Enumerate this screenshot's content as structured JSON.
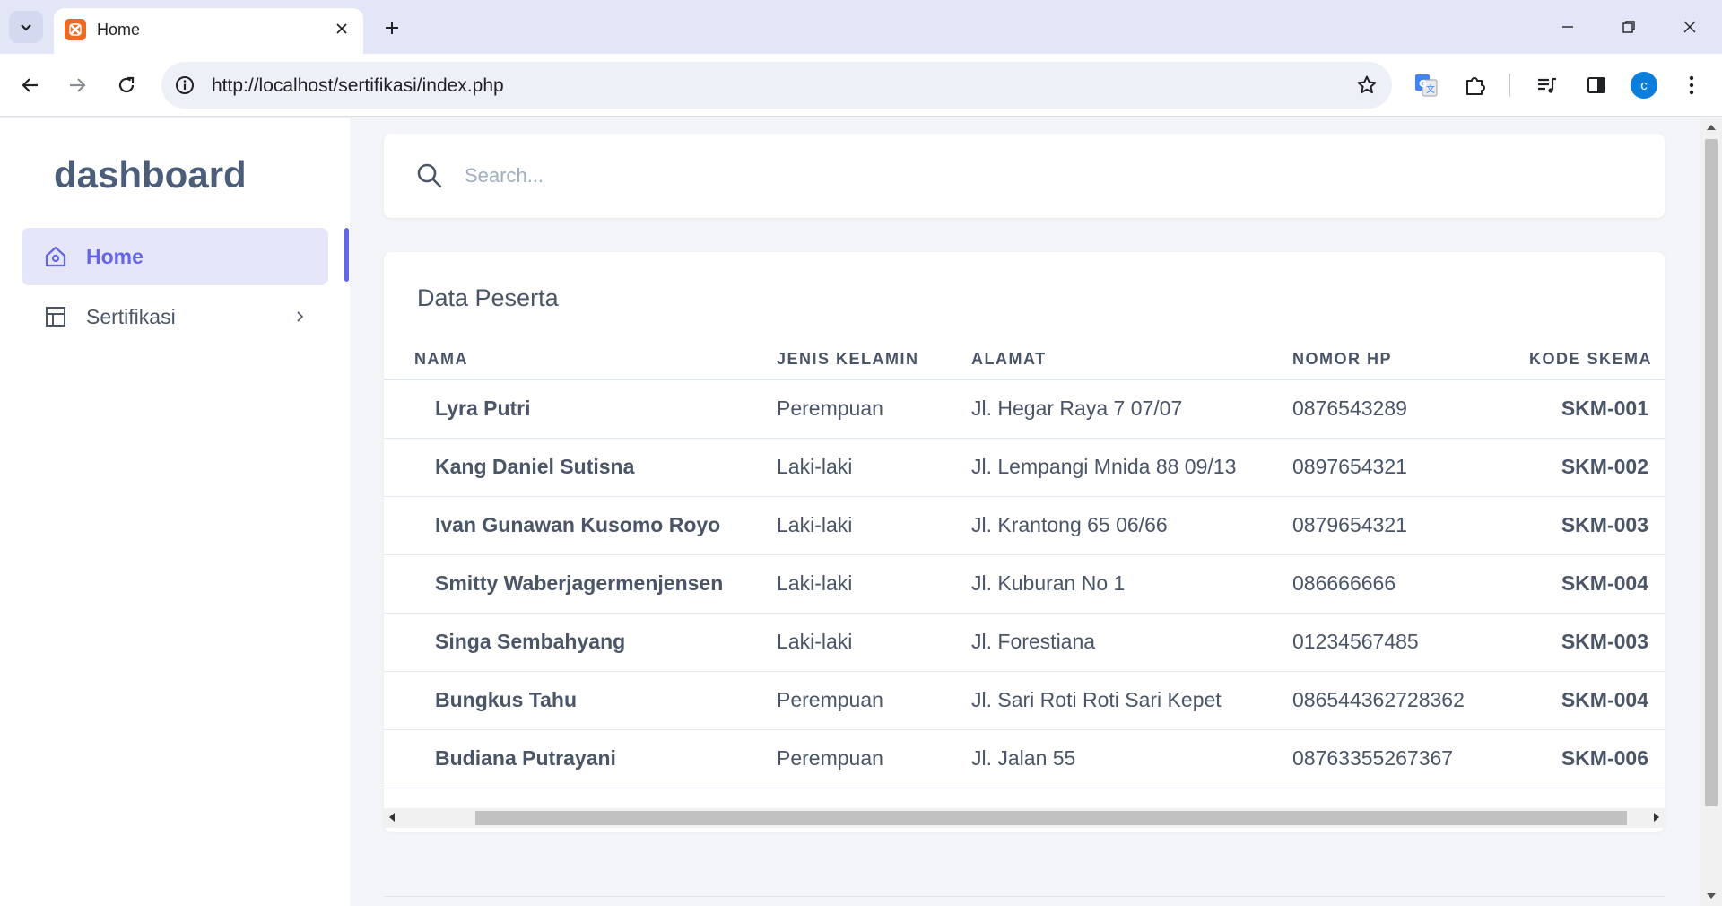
{
  "browser": {
    "tab_title": "Home",
    "url": "http://localhost/sertifikasi/index.php",
    "profile_initial": "c"
  },
  "sidebar": {
    "brand": "dashboard",
    "items": [
      {
        "label": "Home",
        "icon": "home-icon",
        "active": true
      },
      {
        "label": "Sertifikasi",
        "icon": "layout-icon",
        "active": false
      }
    ]
  },
  "search": {
    "placeholder": "Search..."
  },
  "table": {
    "title": "Data Peserta",
    "columns": [
      "NAMA",
      "JENIS KELAMIN",
      "ALAMAT",
      "NOMOR HP",
      "KODE SKEMA"
    ],
    "rows": [
      {
        "nama": "Lyra Putri",
        "jenis_kelamin": "Perempuan",
        "alamat": "Jl. Hegar Raya 7 07/07",
        "nomor_hp": "0876543289",
        "kode_skema": "SKM-001"
      },
      {
        "nama": "Kang Daniel Sutisna",
        "jenis_kelamin": "Laki-laki",
        "alamat": "Jl. Lempangi Mnida 88 09/13",
        "nomor_hp": "0897654321",
        "kode_skema": "SKM-002"
      },
      {
        "nama": "Ivan Gunawan Kusomo Royo",
        "jenis_kelamin": "Laki-laki",
        "alamat": "Jl. Krantong 65 06/66",
        "nomor_hp": "0879654321",
        "kode_skema": "SKM-003"
      },
      {
        "nama": "Smitty Waberjagermenjensen",
        "jenis_kelamin": "Laki-laki",
        "alamat": "Jl. Kuburan No 1",
        "nomor_hp": "086666666",
        "kode_skema": "SKM-004"
      },
      {
        "nama": "Singa Sembahyang",
        "jenis_kelamin": "Laki-laki",
        "alamat": "Jl. Forestiana",
        "nomor_hp": "01234567485",
        "kode_skema": "SKM-003"
      },
      {
        "nama": "Bungkus Tahu",
        "jenis_kelamin": "Perempuan",
        "alamat": "Jl. Sari Roti Roti Sari Kepet",
        "nomor_hp": "086544362728362",
        "kode_skema": "SKM-004"
      },
      {
        "nama": "Budiana Putrayani",
        "jenis_kelamin": "Perempuan",
        "alamat": "Jl. Jalan 55",
        "nomor_hp": "08763355267367",
        "kode_skema": "SKM-006"
      }
    ]
  },
  "colors": {
    "accent": "#6366f1",
    "active_bg": "#e6e6fb",
    "text": "#4a5568",
    "favicon": "#ee6a23",
    "avatar": "#0b7dda"
  }
}
